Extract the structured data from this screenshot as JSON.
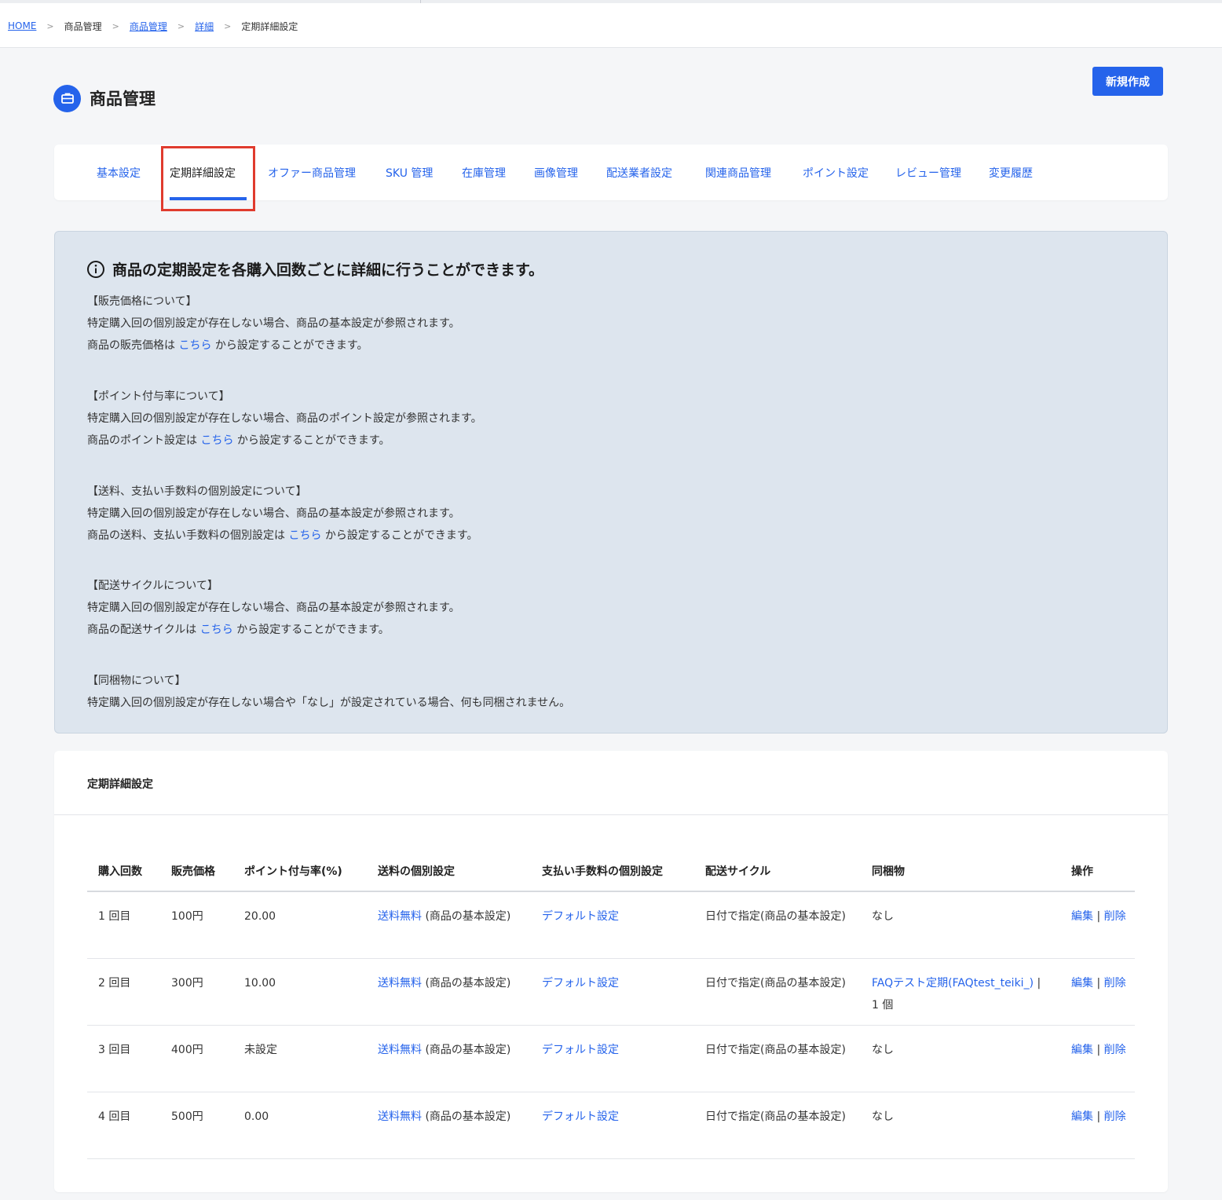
{
  "breadcrumb": {
    "home": "HOME",
    "item1": "商品管理",
    "item2": "商品管理",
    "item3": "詳細",
    "current": "定期詳細設定",
    "separator": ">"
  },
  "header": {
    "title": "商品管理",
    "icon": "briefcase-icon",
    "new_button": "新規作成"
  },
  "tabs": [
    {
      "label": "基本設定"
    },
    {
      "label": "定期詳細設定"
    },
    {
      "label": "オファー商品管理"
    },
    {
      "label": "SKU 管理"
    },
    {
      "label": "在庫管理"
    },
    {
      "label": "画像管理"
    },
    {
      "label": "配送業者設定"
    },
    {
      "label": "関連商品管理"
    },
    {
      "label": "ポイント設定"
    },
    {
      "label": "レビュー管理"
    },
    {
      "label": "変更履歴"
    }
  ],
  "info": {
    "heading": "商品の定期設定を各購入回数ごとに詳細に行うことができます。",
    "sections": [
      {
        "title": "【販売価格について】",
        "line1": "特定購入回の個別設定が存在しない場合、商品の基本設定が参照されます。",
        "line2_pre": "商品の販売価格は ",
        "link": "こちら",
        "line2_post": " から設定することができます。"
      },
      {
        "title": "【ポイント付与率について】",
        "line1": "特定購入回の個別設定が存在しない場合、商品のポイント設定が参照されます。",
        "line2_pre": "商品のポイント設定は ",
        "link": "こちら",
        "line2_post": " から設定することができます。"
      },
      {
        "title": "【送料、支払い手数料の個別設定について】",
        "line1": "特定購入回の個別設定が存在しない場合、商品の基本設定が参照されます。",
        "line2_pre": "商品の送料、支払い手数料の個別設定は ",
        "link": "こちら",
        "line2_post": " から設定することができます。"
      },
      {
        "title": "【配送サイクルについて】",
        "line1": "特定購入回の個別設定が存在しない場合、商品の基本設定が参照されます。",
        "line2_pre": "商品の配送サイクルは ",
        "link": "こちら",
        "line2_post": " から設定することができます。"
      },
      {
        "title": "【同梱物について】",
        "line1": "特定購入回の個別設定が存在しない場合や「なし」が設定されている場合、何も同梱されません。"
      }
    ]
  },
  "table_card": {
    "title": "定期詳細設定",
    "columns": [
      "購入回数",
      "販売価格",
      "ポイント付与率(%)",
      "送料の個別設定",
      "支払い手数料の個別設定",
      "配送サイクル",
      "同梱物",
      "操作"
    ],
    "rows": [
      {
        "count": "1 回目",
        "price": "100円",
        "point_rate": "20.00",
        "shipping_link": "送料無料",
        "shipping_note": "(商品の基本設定)",
        "fee_link": "デフォルト設定",
        "cycle": "日付で指定(商品の基本設定)",
        "bundle": "なし",
        "edit": "編集",
        "op_sep": " | ",
        "delete": "削除"
      },
      {
        "count": "2 回目",
        "price": "300円",
        "point_rate": "10.00",
        "shipping_link": "送料無料",
        "shipping_note": "(商品の基本設定)",
        "fee_link": "デフォルト設定",
        "cycle": "日付で指定(商品の基本設定)",
        "bundle_link": "FAQテスト定期(FAQtest_teiki_)",
        "bundle_qty": " | 1 個",
        "edit": "編集",
        "op_sep": " | ",
        "delete": "削除"
      },
      {
        "count": "3 回目",
        "price": "400円",
        "point_rate": "未設定",
        "shipping_link": "送料無料",
        "shipping_note": "(商品の基本設定)",
        "fee_link": "デフォルト設定",
        "cycle": "日付で指定(商品の基本設定)",
        "bundle": "なし",
        "edit": "編集",
        "op_sep": " | ",
        "delete": "削除"
      },
      {
        "count": "4 回目",
        "price": "500円",
        "point_rate": "0.00",
        "shipping_link": "送料無料",
        "shipping_note": "(商品の基本設定)",
        "fee_link": "デフォルト設定",
        "cycle": "日付で指定(商品の基本設定)",
        "bundle": "なし",
        "edit": "編集",
        "op_sep": " | ",
        "delete": "削除"
      }
    ]
  },
  "colors": {
    "accent": "#2563eb",
    "highlight": "#e03b2e",
    "info_bg": "#dde5ee"
  }
}
